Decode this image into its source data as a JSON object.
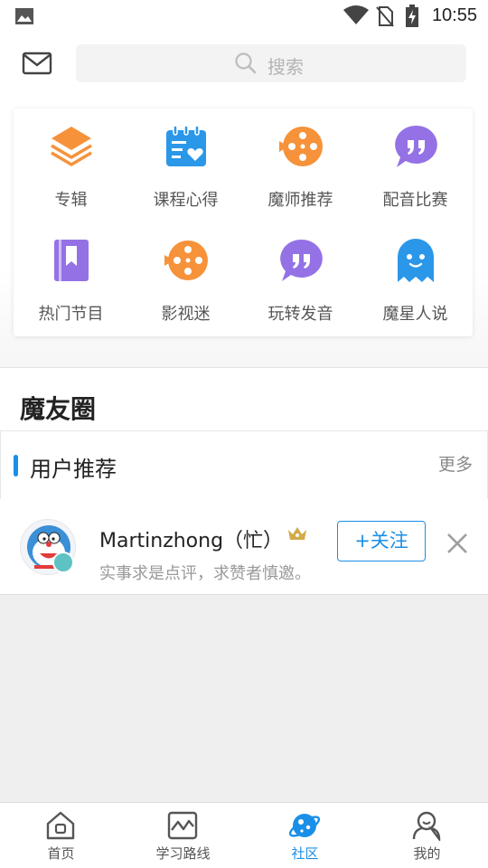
{
  "status_bar": {
    "time": "10:55",
    "icons": [
      "image-icon",
      "wifi-icon",
      "no-sim-icon",
      "battery-charging-icon"
    ]
  },
  "header": {
    "mail_icon": "mail-icon",
    "search": {
      "icon": "search-icon",
      "placeholder": "搜索"
    }
  },
  "grid": {
    "items": [
      {
        "label": "专辑",
        "icon": "layers-icon",
        "color": "#f6923a"
      },
      {
        "label": "课程心得",
        "icon": "notebook-heart-icon",
        "color": "#2a97e9"
      },
      {
        "label": "魔师推荐",
        "icon": "film-reel-icon",
        "color": "#f6923a"
      },
      {
        "label": "配音比赛",
        "icon": "quote-bubble-icon",
        "color": "#9472e6"
      },
      {
        "label": "热门节目",
        "icon": "book-icon",
        "color": "#9472e6"
      },
      {
        "label": "影视迷",
        "icon": "film-reel-icon",
        "color": "#f6923a"
      },
      {
        "label": "玩转发音",
        "icon": "quote-bubble-icon",
        "color": "#9472e6"
      },
      {
        "label": "魔星人说",
        "icon": "ghost-icon",
        "color": "#2a97e9"
      }
    ]
  },
  "moyou": {
    "title": "魔友圈"
  },
  "recommend": {
    "title": "用户推荐",
    "more": "更多",
    "accent": "#1a8fe8",
    "user": {
      "name": "Martinzhong（忙）",
      "bio": "实事求是点评，求赞者慎邀。",
      "follow_label": "+关注",
      "badge_icon": "crown-icon",
      "close_icon": "close-icon"
    }
  },
  "tab_bar": {
    "tabs": [
      {
        "label": "首页",
        "icon": "home-icon",
        "active": false
      },
      {
        "label": "学习路线",
        "icon": "route-chart-icon",
        "active": false
      },
      {
        "label": "社区",
        "icon": "planet-icon",
        "active": true
      },
      {
        "label": "我的",
        "icon": "user-icon",
        "active": false
      }
    ],
    "active_color": "#1a8fe8"
  }
}
